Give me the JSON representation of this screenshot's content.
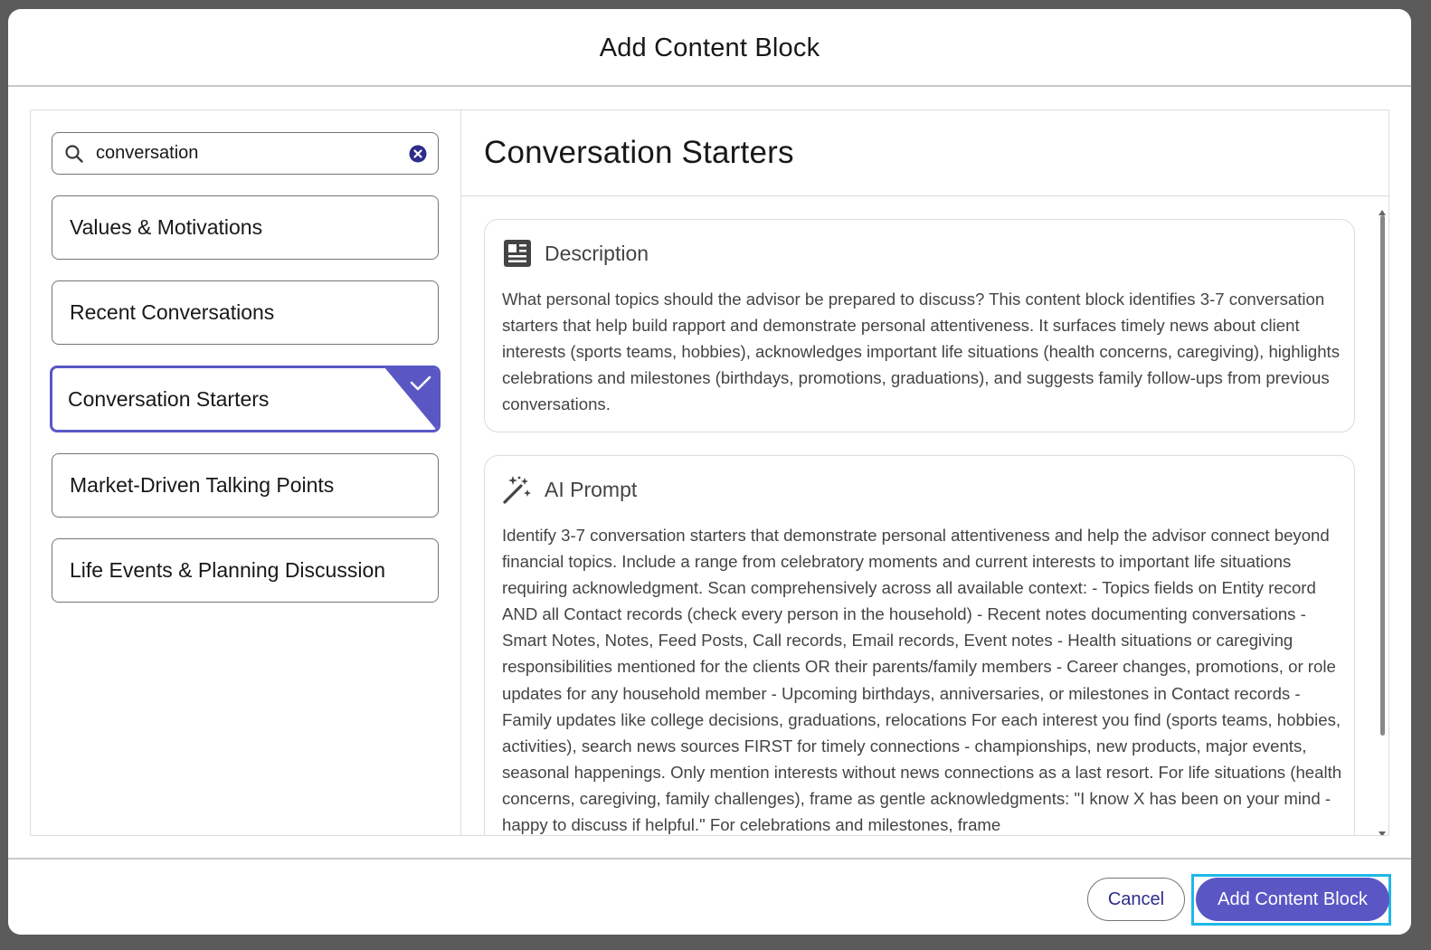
{
  "modal": {
    "title": "Add Content Block"
  },
  "search": {
    "value": "conversation",
    "icon": "search-icon",
    "clear_icon": "clear-circle-icon"
  },
  "blocks": [
    {
      "label": "Values & Motivations",
      "selected": false
    },
    {
      "label": "Recent Conversations",
      "selected": false
    },
    {
      "label": "Conversation Starters",
      "selected": true
    },
    {
      "label": "Market-Driven Talking Points",
      "selected": false
    },
    {
      "label": "Life Events & Planning Discussion",
      "selected": false
    }
  ],
  "detail": {
    "title": "Conversation Starters",
    "description": {
      "label": "Description",
      "icon": "news-icon",
      "text": "What personal topics should the advisor be prepared to discuss? This content block identifies 3-7 conversation starters that help build rapport and demonstrate personal attentiveness. It surfaces timely news about client interests (sports teams, hobbies), acknowledges important life situations (health concerns, caregiving), highlights celebrations and milestones (birthdays, promotions, graduations), and suggests family follow-ups from previous conversations."
    },
    "ai_prompt": {
      "label": "AI Prompt",
      "icon": "magic-wand-icon",
      "text": "Identify 3-7 conversation starters that demonstrate personal attentiveness and help the advisor connect beyond financial topics. Include a range from celebratory moments and current interests to important life situations requiring acknowledgment. Scan comprehensively across all available context: - Topics fields on Entity record AND all Contact records (check every person in the household) - Recent notes documenting conversations - Smart Notes, Notes, Feed Posts, Call records, Email records, Event notes - Health situations or caregiving responsibilities mentioned for the clients OR their parents/family members - Career changes, promotions, or role updates for any household member - Upcoming birthdays, anniversaries, or milestones in Contact records - Family updates like college decisions, graduations, relocations For each interest you find (sports teams, hobbies, activities), search news sources FIRST for timely connections - championships, new products, major events, seasonal happenings. Only mention interests without news connections as a last resort. For life situations (health concerns, caregiving, family challenges), frame as gentle acknowledgments: \"I know X has been on your mind - happy to discuss if helpful.\" For celebrations and milestones, frame"
    }
  },
  "footer": {
    "cancel_label": "Cancel",
    "add_label": "Add Content Block"
  },
  "colors": {
    "accent": "#5a57c5",
    "focus_ring": "#1fb8e8",
    "cancel_text": "#2e2d8a"
  }
}
